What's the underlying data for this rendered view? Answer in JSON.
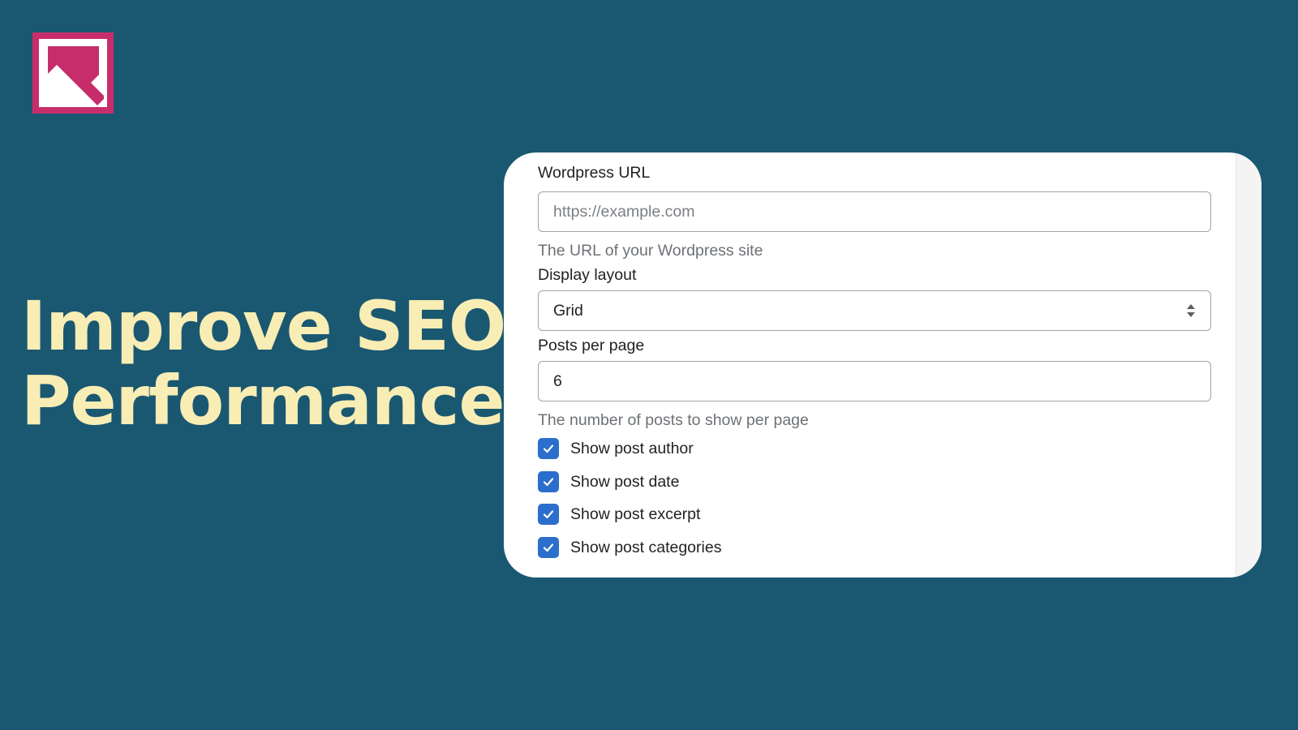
{
  "brand": {
    "logo_icon": "image-arrow-logo-icon",
    "colors": {
      "background": "#1a5872",
      "headline": "#f8edb4",
      "logo": "#c82d6b",
      "checkbox": "#2c6ecb"
    }
  },
  "headline": {
    "line1": "Improve SEO",
    "line2": "Performance"
  },
  "form": {
    "wordpress_url": {
      "label": "Wordpress URL",
      "value": "",
      "placeholder": "https://example.com",
      "help": "The URL of your Wordpress site"
    },
    "display_layout": {
      "label": "Display layout",
      "selected": "Grid",
      "icon": "select-arrows-icon"
    },
    "posts_per_page": {
      "label": "Posts per page",
      "value": "6",
      "help": "The number of posts to show per page"
    },
    "checkboxes": [
      {
        "label": "Show post author",
        "checked": true
      },
      {
        "label": "Show post date",
        "checked": true
      },
      {
        "label": "Show post excerpt",
        "checked": true
      },
      {
        "label": "Show post categories",
        "checked": true
      }
    ]
  }
}
